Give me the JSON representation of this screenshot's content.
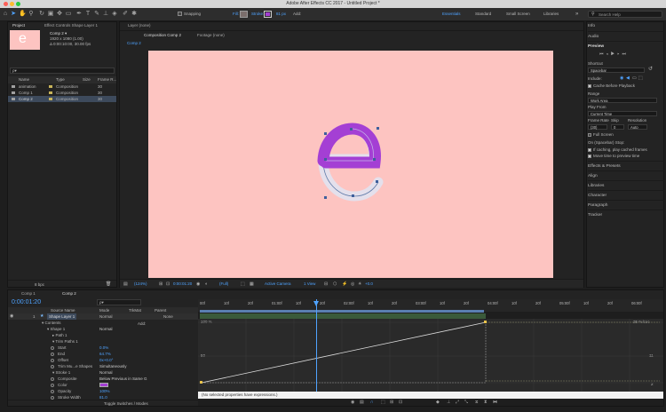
{
  "window": {
    "title": "Adobe After Effects CC 2017 - Untitled Project *"
  },
  "toolbar": {
    "snapping_label": "Snapping",
    "fill_label": "Fill:",
    "stroke_label": "Stroke:",
    "stroke_width": "81 px",
    "add_label": "Add:",
    "workspaces": [
      "Essentials",
      "Standard",
      "Small Screen",
      "Libraries"
    ],
    "search_placeholder": "Search Help",
    "fill_color": "#7a6e6c",
    "stroke_color": "#a43fd4"
  },
  "project_panel": {
    "tabs": {
      "project": "Project",
      "effect_controls": "Effect Controls Shape Layer 1"
    },
    "comp_name": "Comp 2 ▾",
    "comp_size": "1920 x 1080 (1.00)",
    "comp_duration": "Δ 0:00:10:00, 30.00 fps",
    "search_placeholder": "ρ▾",
    "columns": {
      "name": "Name",
      "type": "Type",
      "size": "Size",
      "frame_rate": "Frame R..."
    },
    "items": [
      {
        "name": "animation",
        "type": "Composition",
        "fps": "30"
      },
      {
        "name": "Comp 1",
        "type": "Composition",
        "fps": "30"
      },
      {
        "name": "Comp 2",
        "type": "Composition",
        "fps": "30"
      }
    ],
    "bpc": "8 bpc"
  },
  "viewer": {
    "tabs": {
      "layer": "Layer (none)",
      "composition": "Composition Comp 2",
      "footage": "Footage (none)"
    },
    "breadcrumb": "Comp 2",
    "zoom": "(124%)",
    "timecode": "0:00:01:20",
    "resolution": "(Full)",
    "camera": "Active Camera",
    "views": "1 View",
    "exposure": "+0.0",
    "canvas_color": "#fdc4c1",
    "letter_color": "#a43fd4"
  },
  "right_panel": {
    "top_items": [
      "Info",
      "Audio"
    ],
    "preview": {
      "title": "Preview",
      "shortcut_label": "Shortcut",
      "shortcut_value": "Spacebar",
      "include_label": "Include:",
      "cache_label": "Cache Before Playback",
      "range_label": "Range",
      "range_value": "Work Area",
      "play_from_label": "Play From",
      "play_from_value": "Current Time",
      "frame_rate_label": "Frame Rate",
      "skip_label": "Skip",
      "resolution_label": "Resolution",
      "frame_rate_value": "(30)",
      "skip_value": "0",
      "resolution_value": "Auto",
      "full_screen_label": "Full Screen",
      "on_stop_label": "On (Spacebar) Stop:",
      "if_caching_label": "If caching, play cached frames",
      "move_time_label": "Move time to preview time"
    },
    "sections": [
      "Effects & Presets",
      "Align",
      "Libraries",
      "Character",
      "Paragraph",
      "Tracker"
    ]
  },
  "timeline": {
    "tabs": [
      "Comp 1",
      "Comp 2"
    ],
    "timecode": "0:00:01:20",
    "search_placeholder": "ρ▾",
    "columns": {
      "source_name": "Source Name",
      "mode": "Mode",
      "trkmat": "TrkMat",
      "parent": "Parent"
    },
    "layer": {
      "num": "1",
      "name": "Shape Layer 1",
      "mode": "Normal",
      "parent": "None"
    },
    "props": [
      {
        "label": "▾ Contents",
        "value": "",
        "indent": 0
      },
      {
        "label": "▾ Shape 1",
        "value": "Normal",
        "indent": 1
      },
      {
        "label": "▸ Path 1",
        "value": "",
        "indent": 2
      },
      {
        "label": "▾ Trim Paths 1",
        "value": "",
        "indent": 2
      },
      {
        "label": "Start",
        "value": "0.0%",
        "indent": 3
      },
      {
        "label": "End",
        "value": "64.7%",
        "indent": 3
      },
      {
        "label": "Offset",
        "value": "0x+0.0°",
        "indent": 3
      },
      {
        "label": "Trim Mu...e Shapes",
        "value": "Simultaneously",
        "indent": 3
      },
      {
        "label": "▾ Stroke 1",
        "value": "Normal",
        "indent": 2
      },
      {
        "label": "Composite",
        "value": "Below Previous in Same G",
        "indent": 3
      },
      {
        "label": "Color",
        "value": "",
        "indent": 3
      },
      {
        "label": "Opacity",
        "value": "100%",
        "indent": 3
      },
      {
        "label": "Stroke Width",
        "value": "81.0",
        "indent": 3
      }
    ],
    "add_label": "Add:",
    "toggle_label": "Toggle Switches / Modes",
    "ruler_labels": [
      "00f",
      "10f",
      "20f",
      "01:00f",
      "10f",
      "20f",
      "02:00f",
      "10f",
      "20f",
      "03:00f",
      "10f",
      "20f",
      "04:00f",
      "10f",
      "20f",
      "05:00f",
      "10f",
      "20f",
      "06:00f"
    ],
    "graph": {
      "top_label": "100 %",
      "mid_label": "50",
      "right_top": "25 %/sec",
      "right_mid": "11",
      "right_bottom": "2",
      "status": "(No selected properties have expressions.)"
    }
  }
}
